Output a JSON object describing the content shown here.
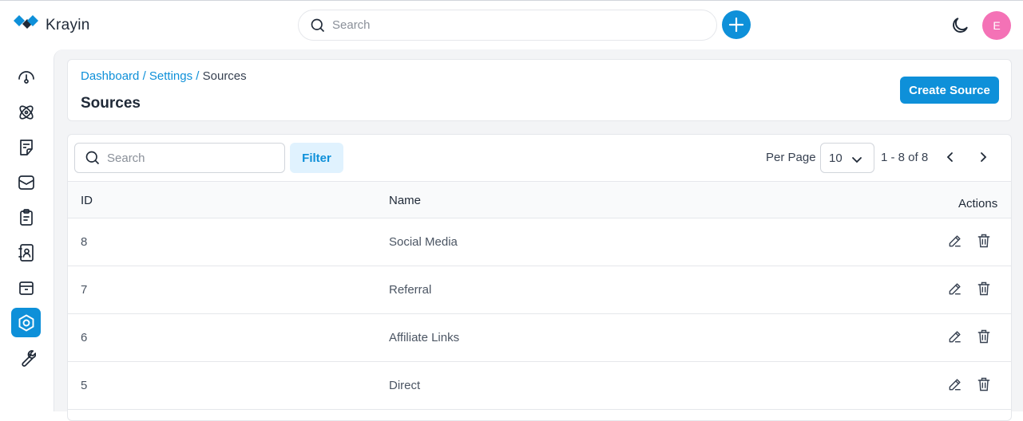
{
  "app": {
    "name": "Krayin"
  },
  "topbar": {
    "search_placeholder": "Search",
    "avatar_initial": "E"
  },
  "sidebar": {
    "items": [
      {
        "icon": "dashboard-icon"
      },
      {
        "icon": "leads-icon"
      },
      {
        "icon": "quotes-icon"
      },
      {
        "icon": "mail-icon"
      },
      {
        "icon": "activities-icon"
      },
      {
        "icon": "contacts-icon"
      },
      {
        "icon": "products-icon"
      },
      {
        "icon": "settings-icon",
        "active": true
      },
      {
        "icon": "configuration-icon"
      }
    ]
  },
  "breadcrumb": {
    "dashboard": "Dashboard",
    "settings": "Settings",
    "current": "Sources",
    "separator": "/"
  },
  "page": {
    "title": "Sources",
    "create_label": "Create Source"
  },
  "toolbar": {
    "search_placeholder": "Search",
    "filter_label": "Filter",
    "per_page_label": "Per Page",
    "per_page_value": "10",
    "range": "1 - 8 of 8"
  },
  "table": {
    "headers": {
      "id": "ID",
      "name": "Name",
      "actions": "Actions"
    },
    "rows": [
      {
        "id": "8",
        "name": "Social Media"
      },
      {
        "id": "7",
        "name": "Referral"
      },
      {
        "id": "6",
        "name": "Affiliate Links"
      },
      {
        "id": "5",
        "name": "Direct"
      }
    ]
  },
  "colors": {
    "accent": "#0e90d9",
    "avatar": "#f472b6",
    "filter_bg": "#e0f2fe"
  }
}
